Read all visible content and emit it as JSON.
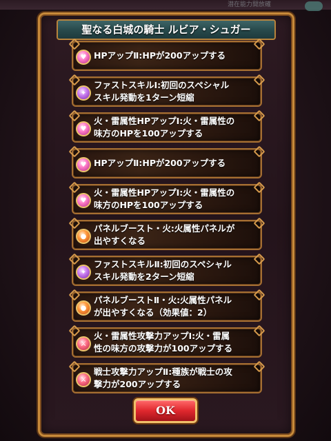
{
  "background": {
    "banner_text": "潜在能力開放確"
  },
  "dialog": {
    "title": "聖なる白城の騎士 ルビア・シュガー",
    "ok_label": "OK"
  },
  "awakenings": [
    {
      "text": "HPアップⅡ:HPが200アップする",
      "icon": "hp-up-icon"
    },
    {
      "text": "ファストスキルⅠ:初回のスペシャル\nスキル発動を1ターン短縮",
      "icon": "fast-skill-icon"
    },
    {
      "text": "火・雷属性HPアップⅠ:火・雷属性の\n味方のHPを100アップする",
      "icon": "element-hp-up-icon"
    },
    {
      "text": "HPアップⅡ:HPが200アップする",
      "icon": "hp-up-icon"
    },
    {
      "text": "火・雷属性HPアップⅠ:火・雷属性の\n味方のHPを100アップする",
      "icon": "element-hp-up-icon"
    },
    {
      "text": "パネルブースト・火:火属性パネルが\n出やすくなる",
      "icon": "panel-boost-icon"
    },
    {
      "text": "ファストスキルⅡ:初回のスペシャル\nスキル発動を2ターン短縮",
      "icon": "fast-skill-icon"
    },
    {
      "text": "パネルブーストⅡ・火:火属性パネル\nが出やすくなる（効果値：2）",
      "icon": "panel-boost-icon"
    },
    {
      "text": "火・雷属性攻撃力アップⅠ:火・雷属\n性の味方の攻撃力が100アップする",
      "icon": "element-attack-up-icon"
    },
    {
      "text": "戦士攻撃力アップⅡ:種族が戦士の攻\n撃力が200アップする",
      "icon": "race-attack-up-icon"
    }
  ]
}
